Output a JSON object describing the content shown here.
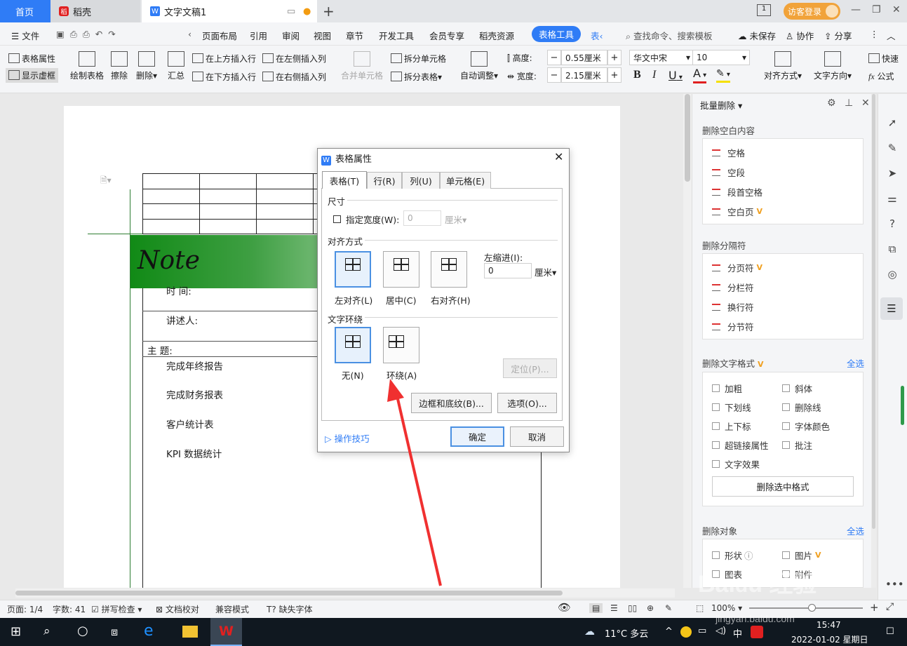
{
  "tabs": {
    "home": "首页",
    "daoke": "稻壳",
    "doc": "文字文稿1"
  },
  "visit_login": "访客登录",
  "menu": {
    "file": "文件",
    "items": [
      "页面布局",
      "引用",
      "审阅",
      "视图",
      "章节",
      "开发工具",
      "会员专享",
      "稻壳资源"
    ],
    "active_tool": "表格工具",
    "next": "表‹",
    "search": "查找命令、搜索模板",
    "unsaved": "未保存",
    "collab": "协作",
    "share": "分享"
  },
  "ribbon": {
    "table_props": "表格属性",
    "show_grid": "显示虚框",
    "draw_table": "绘制表格",
    "erase": "擦除",
    "delete": "删除",
    "summary": "汇总",
    "insert_above": "在上方插入行",
    "insert_below": "在下方插入行",
    "insert_left": "在左侧插入列",
    "insert_right": "在右侧插入列",
    "merge_cells": "合并单元格",
    "split_cells": "拆分单元格",
    "split_table": "拆分表格",
    "auto_adjust": "自动调整",
    "height_label": "高度:",
    "height_value": "0.55厘米",
    "width_label": "宽度:",
    "width_value": "2.15厘米",
    "font": "华文中宋",
    "font_size": "10",
    "bold": "B",
    "italic": "I",
    "underline": "U",
    "font_color": "A",
    "align": "对齐方式",
    "text_dir": "文字方向",
    "quick": "快速",
    "formula": "公式"
  },
  "doc": {
    "note": "Note",
    "time": "时    间:",
    "speaker": "讲述人:",
    "topic": "主    题:",
    "items": [
      "完成年终报告",
      "完成财务报表",
      "客户统计表",
      "KPI 数据统计"
    ]
  },
  "dialog": {
    "title": "表格属性",
    "tabs": [
      "表格(T)",
      "行(R)",
      "列(U)",
      "单元格(E)"
    ],
    "size": "尺寸",
    "specify_width": "指定宽度(W):",
    "width_val": "0",
    "unit": "厘米",
    "alignment": "对齐方式",
    "align_left": "左对齐(L)",
    "align_center": "居中(C)",
    "align_right": "右对齐(H)",
    "indent_label": "左缩进(I):",
    "indent_val": "0",
    "wrap": "文字环绕",
    "wrap_none": "无(N)",
    "wrap_around": "环绕(A)",
    "position": "定位(P)...",
    "borders": "边框和底纹(B)...",
    "options": "选项(O)...",
    "tips": "操作技巧",
    "ok": "确定",
    "cancel": "取消"
  },
  "panel": {
    "title": "批量删除",
    "sec1": "删除空白内容",
    "sec1_items": [
      "空格",
      "空段",
      "段首空格",
      "空白页"
    ],
    "sec2": "删除分隔符",
    "sec2_items": [
      "分页符",
      "分栏符",
      "换行符",
      "分节符"
    ],
    "sec3": "删除文字格式",
    "select_all": "全选",
    "sec3_left": [
      "加粗",
      "下划线",
      "上下标",
      "超链接属性",
      "文字效果"
    ],
    "sec3_right": [
      "斜体",
      "删除线",
      "字体颜色",
      "批注"
    ],
    "delete_selected": "删除选中格式",
    "sec4": "删除对象",
    "sec4_left": [
      "形状",
      "图表"
    ],
    "sec4_right": [
      "图片",
      "附件"
    ]
  },
  "status": {
    "page": "页面: 1/4",
    "words": "字数: 41",
    "spell": "拼写检查",
    "proof": "文档校对",
    "compat": "兼容模式",
    "missing_font": "缺失字体",
    "zoom": "100%"
  },
  "taskbar": {
    "weather": "11°C  多云",
    "lang": "中",
    "time": "15:47",
    "date": "2022-01-02 星期日"
  },
  "watermark": "Baidu经验 jingyan.baidu.com"
}
